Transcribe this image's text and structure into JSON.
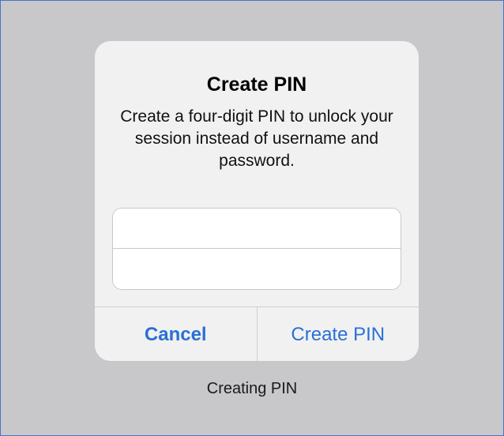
{
  "dialog": {
    "title": "Create PIN",
    "message": "Create a four-digit PIN to unlock your session instead of username and password.",
    "pin_field": {
      "value": "",
      "placeholder": ""
    },
    "confirm_field": {
      "value": "",
      "placeholder": ""
    },
    "cancel_label": "Cancel",
    "create_label": "Create PIN"
  },
  "caption": "Creating PIN",
  "colors": {
    "accent": "#2a6fd6",
    "backdrop": "#c8c8cb",
    "dialog_bg": "#f1f1f2",
    "frame_border": "#4a74c4"
  }
}
